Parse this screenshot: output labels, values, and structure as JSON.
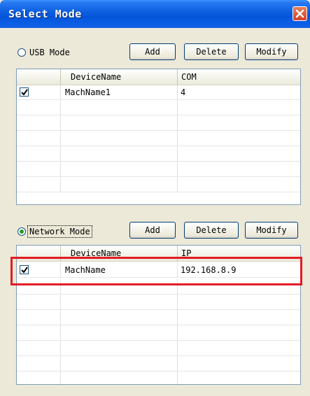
{
  "window": {
    "title": "Select Mode",
    "close_icon": "close-icon"
  },
  "usb": {
    "mode_label": "USB Mode",
    "selected": false,
    "buttons": {
      "add": "Add",
      "delete": "Delete",
      "modify": "Modify"
    },
    "columns": [
      "DeviceName",
      "COM"
    ],
    "rows": [
      {
        "checked": true,
        "name": "MachName1",
        "value": "4"
      }
    ]
  },
  "network": {
    "mode_label": "Network Mode",
    "selected": true,
    "buttons": {
      "add": "Add",
      "delete": "Delete",
      "modify": "Modify"
    },
    "columns": [
      "DeviceName",
      "IP"
    ],
    "rows": [
      {
        "checked": true,
        "name": "MachName",
        "value": "192.168.8.9"
      }
    ]
  },
  "colors": {
    "titlebar": "#0554d8",
    "dialog_bg": "#ece9d8",
    "highlight": "#e31b23",
    "radio_dot": "#21a121"
  }
}
